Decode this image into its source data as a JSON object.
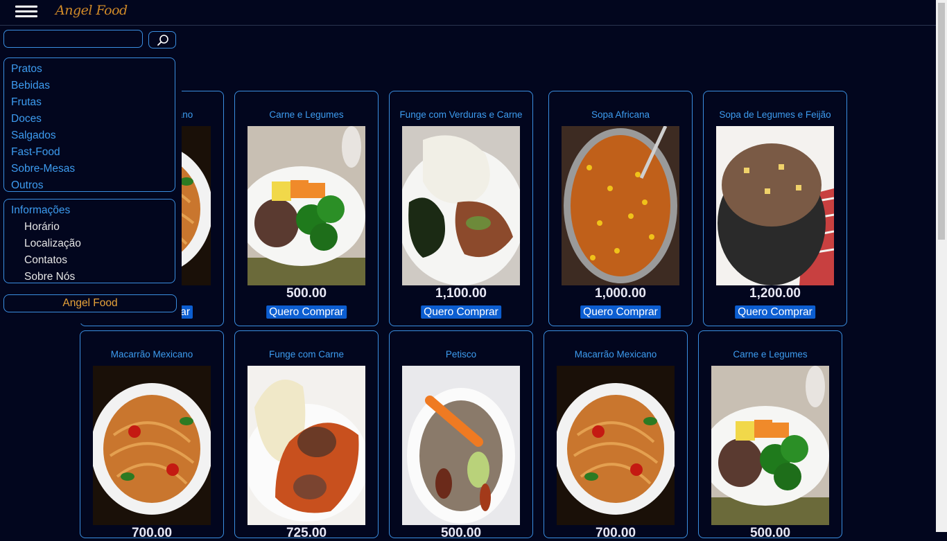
{
  "header": {
    "logo": "Angel Food",
    "menu_icon": "hamburger-menu-icon"
  },
  "search": {
    "value": "",
    "placeholder": "",
    "icon": "search-icon"
  },
  "categories": [
    "Pratos",
    "Bebidas",
    "Frutas",
    "Doces",
    "Salgados",
    "Fast-Food",
    "Sobre-Mesas",
    "Outros"
  ],
  "info": {
    "title": "Informações",
    "items": [
      "Horário",
      "Localização",
      "Contatos",
      "Sobre Nós"
    ]
  },
  "brand": "Angel Food",
  "buy_label": "Quero Comprar",
  "products": [
    {
      "name": "Macarrão Mexicano",
      "price": "",
      "img": "spaghetti",
      "partial_buy": "ar"
    },
    {
      "name": "Carne e Legumes",
      "price": "500.00",
      "img": "meat-veg"
    },
    {
      "name": "Funge com Verduras e Carne",
      "price": "1,100.00",
      "img": "funge-greens"
    },
    {
      "name": "Sopa Africana",
      "price": "1,000.00",
      "img": "corn-stew"
    },
    {
      "name": "Sopa de Legumes e Feijão",
      "price": "1,200.00",
      "img": "bean-soup"
    },
    {
      "name": "Macarrão Mexicano",
      "price": "700.00",
      "img": "spaghetti"
    },
    {
      "name": "Funge com Carne",
      "price": "725.00",
      "img": "funge-meat"
    },
    {
      "name": "Petisco",
      "price": "500.00",
      "img": "petisco"
    },
    {
      "name": "Macarrão Mexicano",
      "price": "700.00",
      "img": "spaghetti"
    },
    {
      "name": "Carne e Legumes",
      "price": "500.00",
      "img": "meat-veg"
    }
  ],
  "colors": {
    "accent": "#3a8ee0",
    "background": "#02061e",
    "button": "#0c5ed1",
    "brand": "#e8a33a"
  }
}
